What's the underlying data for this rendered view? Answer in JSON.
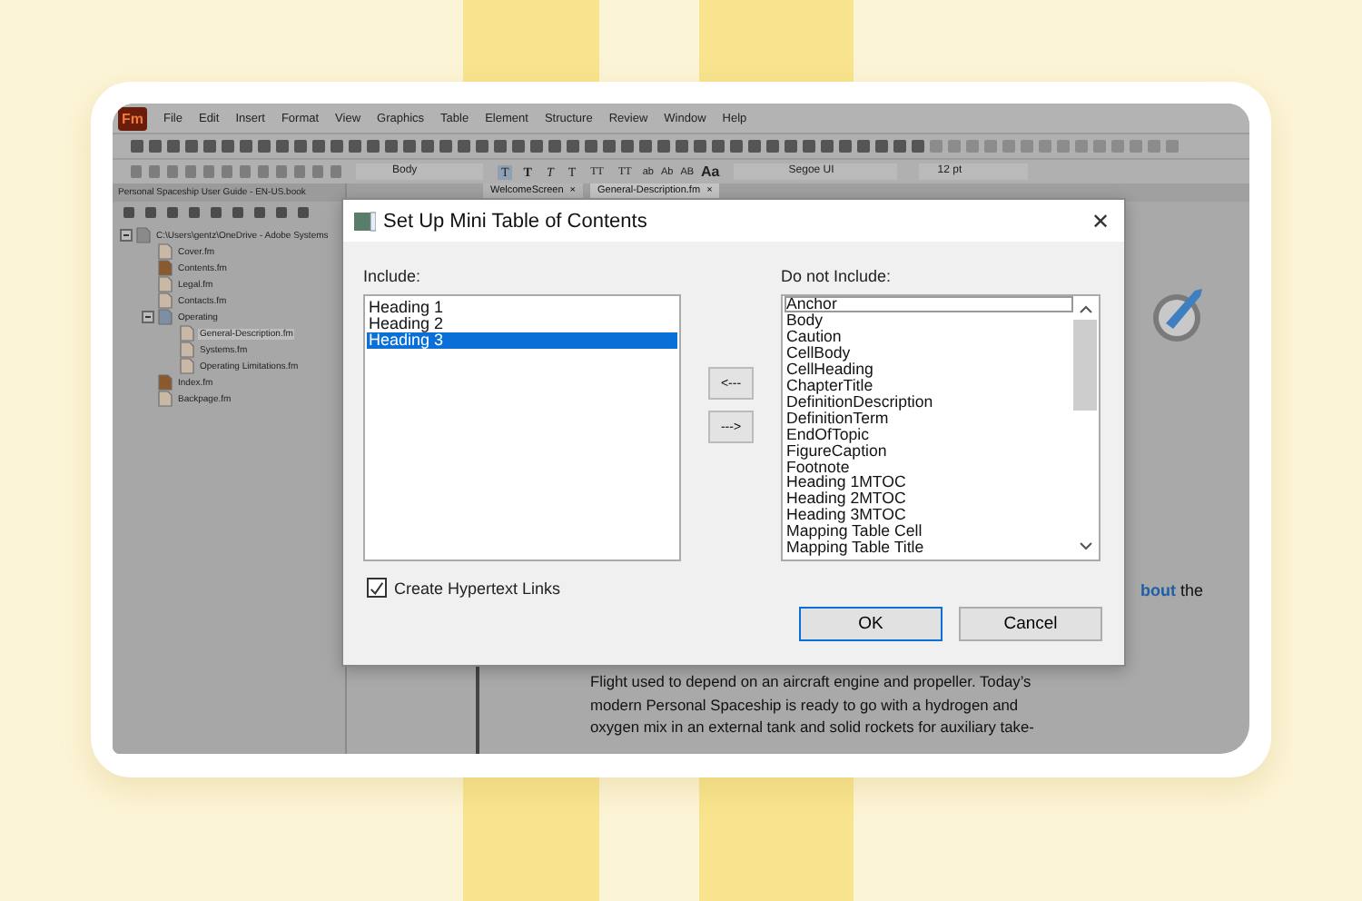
{
  "app": {
    "logo": "Fm",
    "menu": [
      "File",
      "Edit",
      "Insert",
      "Format",
      "View",
      "Graphics",
      "Table",
      "Element",
      "Structure",
      "Review",
      "Window",
      "Help"
    ]
  },
  "format_bar": {
    "paragraph_style": "Body",
    "text_styles": [
      {
        "label": "T",
        "kind": "plain",
        "selected": true
      },
      {
        "label": "T",
        "kind": "bold",
        "selected": false
      },
      {
        "label": "T",
        "kind": "italic",
        "selected": false
      },
      {
        "label": "T",
        "kind": "plain",
        "selected": false
      },
      {
        "label": "TT",
        "kind": "small",
        "selected": false
      },
      {
        "label": "TT",
        "kind": "small",
        "selected": false
      }
    ],
    "case_styles": [
      {
        "label": "ab",
        "kind": "plain"
      },
      {
        "label": "Ab",
        "kind": "plain"
      },
      {
        "label": "AB",
        "kind": "plain"
      },
      {
        "label": "Aa",
        "kind": "large"
      }
    ],
    "font": "Segoe UI",
    "size": "12 pt"
  },
  "tabs": [
    {
      "label": "WelcomeScreen",
      "close": "×",
      "selected": false
    },
    {
      "label": "General-Description.fm",
      "close": "×",
      "selected": true
    }
  ],
  "book_panel": {
    "title": "Personal Spaceship User Guide - EN-US.book",
    "tree": [
      {
        "label": "C:\\Users\\gentz\\OneDrive - Adobe Systems",
        "kind": "drive",
        "selected": false,
        "expanded": true,
        "children": [
          {
            "label": "Cover.fm",
            "kind": "file",
            "selected": false
          },
          {
            "label": "Contents.fm",
            "kind": "generated",
            "selected": false
          },
          {
            "label": "Legal.fm",
            "kind": "file",
            "selected": false
          },
          {
            "label": "Contacts.fm",
            "kind": "file",
            "selected": false
          },
          {
            "label": "Operating",
            "kind": "folder",
            "selected": false,
            "expanded": true,
            "children": [
              {
                "label": "General-Description.fm",
                "kind": "file",
                "selected": true
              },
              {
                "label": "Systems.fm",
                "kind": "file",
                "selected": false
              },
              {
                "label": "Operating Limitations.fm",
                "kind": "file",
                "selected": false
              }
            ]
          },
          {
            "label": "Index.fm",
            "kind": "generated",
            "selected": false
          },
          {
            "label": "Backpage.fm",
            "kind": "file",
            "selected": false
          }
        ]
      }
    ]
  },
  "document": {
    "link_fragment": {
      "link": "bout",
      "rest": " the"
    },
    "paragraph": [
      "Flight used to depend on an aircraft engine and propeller. Today’s",
      "modern Personal Spaceship is ready to go with a hydrogen and",
      "oxygen mix in an external tank and solid rockets for auxiliary take-"
    ]
  },
  "dialog": {
    "title": "Set Up Mini Table of Contents",
    "close": "✕",
    "include_label": "Include:",
    "include": [
      {
        "label": "Heading 1",
        "selected": false
      },
      {
        "label": "Heading 2",
        "selected": false
      },
      {
        "label": "Heading 3",
        "selected": true
      }
    ],
    "move_left": "<---",
    "move_right": "--->",
    "exclude_label": "Do not Include:",
    "exclude": [
      {
        "label": "Anchor",
        "selected": false,
        "focused": true
      },
      {
        "label": "Body",
        "selected": false,
        "focused": false
      },
      {
        "label": "Caution",
        "selected": false,
        "focused": false
      },
      {
        "label": "CellBody",
        "selected": false,
        "focused": false
      },
      {
        "label": "CellHeading",
        "selected": false,
        "focused": false
      },
      {
        "label": "ChapterTitle",
        "selected": false,
        "focused": false
      },
      {
        "label": "DefinitionDescription",
        "selected": false,
        "focused": false
      },
      {
        "label": "DefinitionTerm",
        "selected": false,
        "focused": false
      },
      {
        "label": "EndOfTopic",
        "selected": false,
        "focused": false
      },
      {
        "label": "FigureCaption",
        "selected": false,
        "focused": false
      },
      {
        "label": "Footnote",
        "selected": false,
        "focused": false
      },
      {
        "label": "Heading 1MTOC",
        "selected": false,
        "focused": false
      },
      {
        "label": "Heading 2MTOC",
        "selected": false,
        "focused": false
      },
      {
        "label": "Heading 3MTOC",
        "selected": false,
        "focused": false
      },
      {
        "label": "Mapping Table Cell",
        "selected": false,
        "focused": false
      },
      {
        "label": "Mapping Table Title",
        "selected": false,
        "focused": false
      }
    ],
    "hypertext": {
      "label": "Create Hypertext Links",
      "checked": true
    },
    "ok": "OK",
    "cancel": "Cancel"
  }
}
